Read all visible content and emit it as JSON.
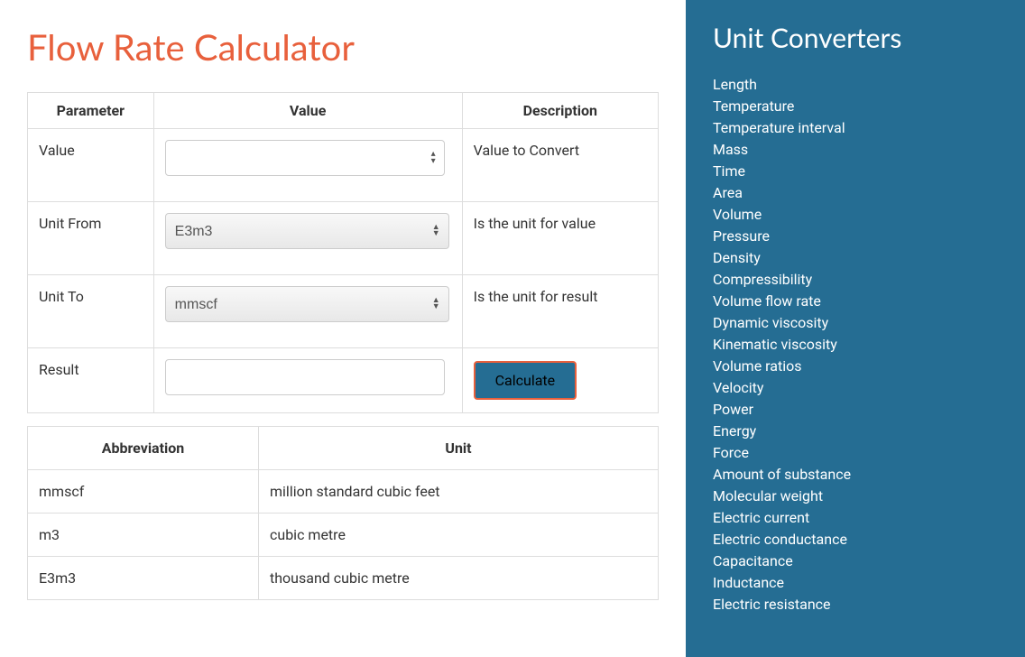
{
  "title": "Flow Rate Calculator",
  "calcTable": {
    "headers": {
      "parameter": "Parameter",
      "value": "Value",
      "description": "Description"
    },
    "rows": {
      "value": {
        "label": "Value",
        "desc": "Value to Convert",
        "inputValue": ""
      },
      "unitFrom": {
        "label": "Unit From",
        "desc": "Is the unit for value",
        "selected": "E3m3"
      },
      "unitTo": {
        "label": "Unit To",
        "desc": "Is the unit for result",
        "selected": "mmscf"
      },
      "result": {
        "label": "Result",
        "inputValue": "",
        "buttonLabel": "Calculate"
      }
    }
  },
  "abbrTable": {
    "headers": {
      "abbr": "Abbreviation",
      "unit": "Unit"
    },
    "rows": [
      {
        "abbr": "mmscf",
        "unit": "million standard cubic feet"
      },
      {
        "abbr": "m3",
        "unit": "cubic metre"
      },
      {
        "abbr": "E3m3",
        "unit": "thousand cubic metre"
      }
    ]
  },
  "sidebar": {
    "title": "Unit Converters",
    "items": [
      "Length",
      "Temperature",
      "Temperature interval",
      "Mass",
      "Time",
      "Area",
      "Volume",
      "Pressure",
      "Density",
      "Compressibility",
      "Volume flow rate",
      "Dynamic viscosity",
      "Kinematic viscosity",
      "Volume ratios",
      "Velocity",
      "Power",
      "Energy",
      "Force",
      "Amount of substance",
      "Molecular weight",
      "Electric current",
      "Electric conductance",
      "Capacitance",
      "Inductance",
      "Electric resistance"
    ]
  }
}
